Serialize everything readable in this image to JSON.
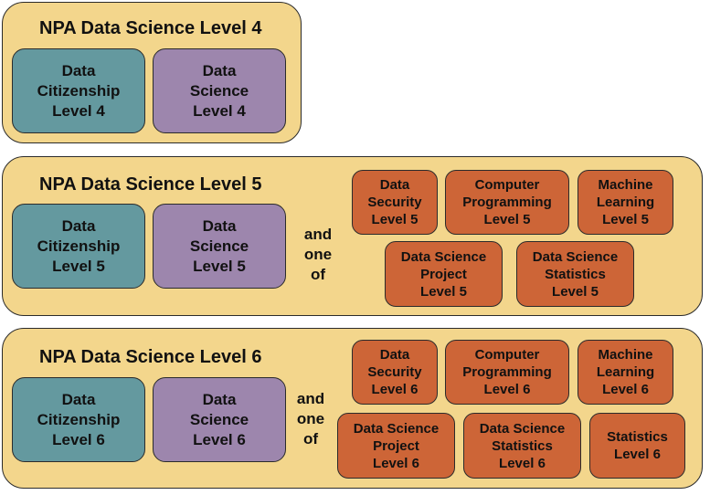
{
  "colors": {
    "panel": "#f3d68c",
    "citizenship": "#64999f",
    "science": "#9d86ad",
    "option": "#cd6537"
  },
  "levels": [
    {
      "title": "NPA Data Science Level 4",
      "core": [
        "Data\nCitizenship\nLevel 4",
        "Data\nScience\nLevel 4"
      ]
    },
    {
      "title": "NPA Data Science Level 5",
      "core": [
        "Data\nCitizenship\nLevel 5",
        "Data\nScience\nLevel 5"
      ],
      "connector": "and\none\nof",
      "options": [
        "Data\nSecurity\nLevel 5",
        "Computer\nProgramming\nLevel 5",
        "Machine\nLearning\nLevel 5",
        "Data Science\nProject\nLevel 5",
        "Data Science\nStatistics\nLevel 5"
      ]
    },
    {
      "title": "NPA Data Science Level 6",
      "core": [
        "Data\nCitizenship\nLevel 6",
        "Data\nScience\nLevel 6"
      ],
      "connector": "and\none\nof",
      "options": [
        "Data\nSecurity\nLevel 6",
        "Computer\nProgramming\nLevel 6",
        "Machine\nLearning\nLevel 6",
        "Data Science\nProject\nLevel 6",
        "Data Science\nStatistics\nLevel 6",
        "Statistics\nLevel 6"
      ]
    }
  ]
}
